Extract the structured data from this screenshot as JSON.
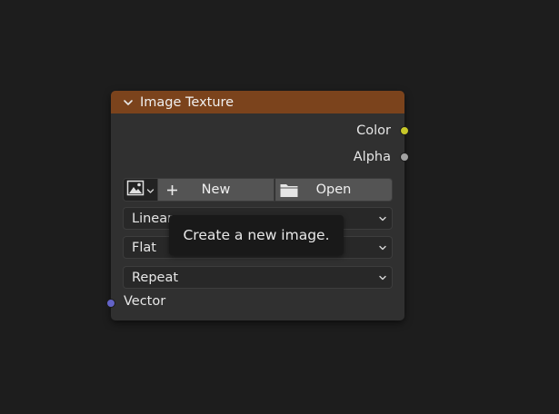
{
  "node": {
    "title": "Image Texture",
    "header_color": "#7b431c",
    "outputs": [
      {
        "label": "Color",
        "socket_color": "#c7c729",
        "icon": "yellow-socket"
      },
      {
        "label": "Alpha",
        "socket_color": "#a1a1a1",
        "icon": "gray-socket"
      }
    ],
    "buttons": {
      "browse_icon": "image-icon",
      "new_label": "New",
      "new_icon": "plus-icon",
      "open_label": "Open",
      "open_icon": "folder-icon"
    },
    "dropdowns": {
      "interpolation": "Linear",
      "projection": "Flat",
      "extension": "Repeat"
    },
    "inputs": [
      {
        "label": "Vector",
        "socket_color": "#6363c7",
        "icon": "purple-socket"
      }
    ]
  },
  "tooltip": {
    "text": "Create a new image."
  }
}
